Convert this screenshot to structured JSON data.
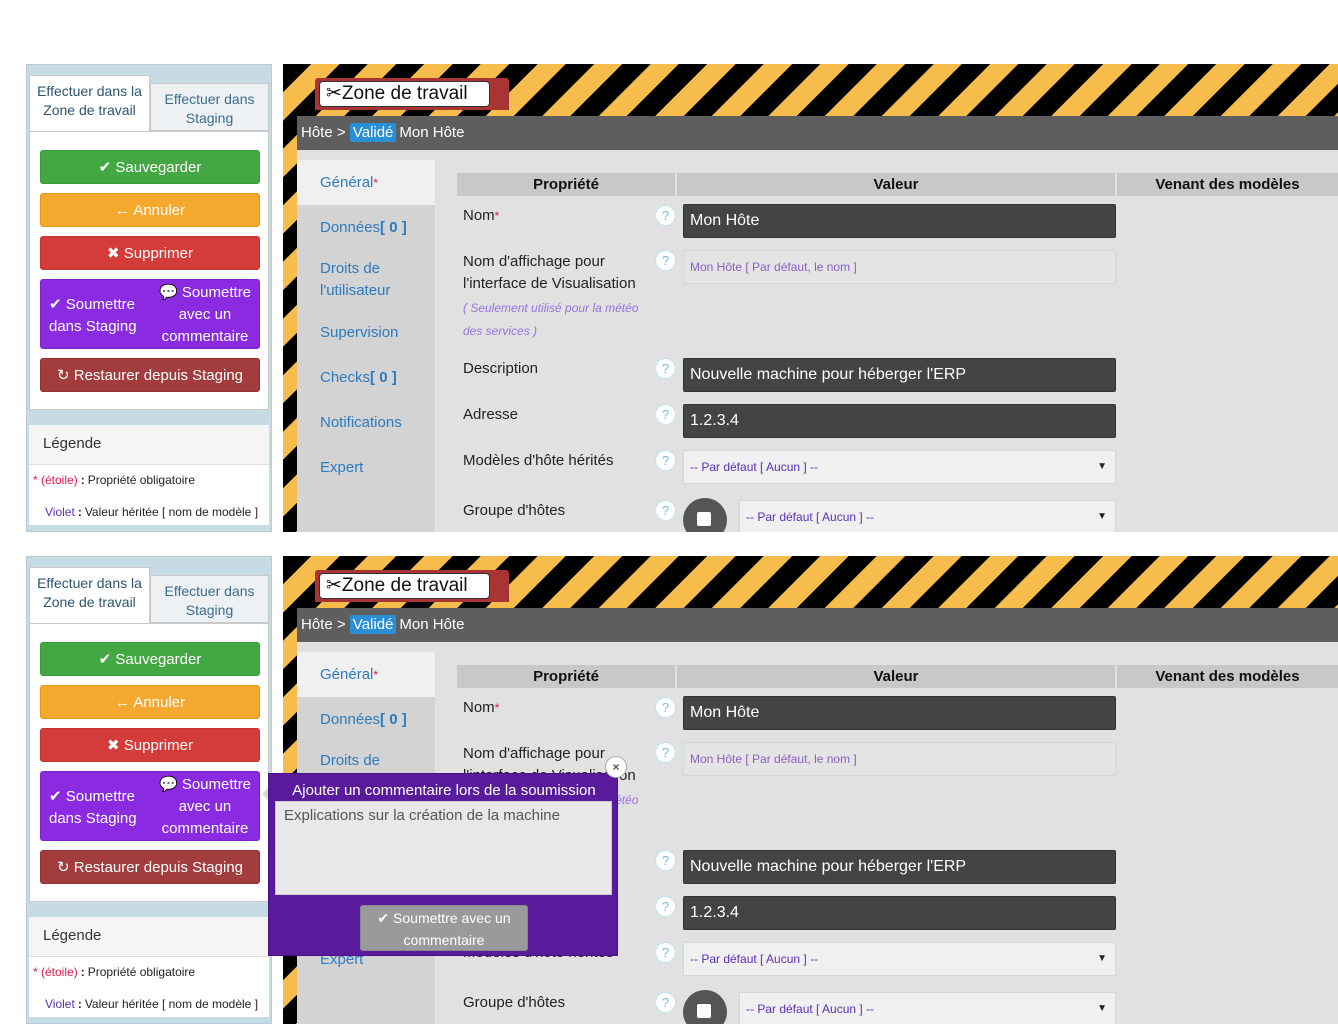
{
  "tabs": {
    "active": "Effectuer dans la Zone de travail",
    "inactive": "Effectuer dans Staging"
  },
  "buttons": {
    "save": "Sauvegarder",
    "cancel": "Annuler",
    "delete": "Supprimer",
    "submit_staging": "Soumettre dans Staging",
    "submit_comment": "Soumettre avec un commentaire",
    "restore": "Restaurer depuis Staging"
  },
  "legend": {
    "title": "Légende",
    "required_mark": "* (étoile)",
    "required_text": "Propriété obligatoire",
    "inherited_mark": "Violet",
    "inherited_text": "Valeur héritée [ nom de modèle ]",
    "separator": ":"
  },
  "zone_title": "Zone de travail",
  "breadcrumb": {
    "root": "Hôte >",
    "status": "Validé",
    "name": "Mon Hôte"
  },
  "nav": [
    {
      "label": "Général",
      "mark": "*"
    },
    {
      "label": "Données",
      "count": "[ 0 ]"
    },
    {
      "label": "Droits de l'utilisateur"
    },
    {
      "label": "Supervision"
    },
    {
      "label": "Checks",
      "count": "[ 0 ]"
    },
    {
      "label": "Notifications"
    },
    {
      "label": "Expert"
    }
  ],
  "table": {
    "col_property": "Propriété",
    "col_value": "Valeur",
    "col_models": "Venant des modèles"
  },
  "rows": {
    "name_label": "Nom",
    "name_mark": "*",
    "name_value": "Mon Hôte",
    "display_label": "Nom d'affichage pour l'interface de Visualisation",
    "display_note": "( Seulement utilisé pour la météo des services )",
    "display_value": "Mon Hôte [ Par défaut, le nom ]",
    "desc_label": "Description",
    "desc_value": "Nouvelle machine pour héberger l'ERP",
    "addr_label": "Adresse",
    "addr_value": "1.2.3.4",
    "templates_label": "Modèles d'hôte hérités",
    "templates_value": "-- Par défaut [ Aucun ] --",
    "group_label": "Groupe d'hôtes",
    "group_value": "-- Par défaut [ Aucun ] --"
  },
  "popover": {
    "title": "Ajouter un commentaire lors de la soumission",
    "text": "Explications sur la création de la machine",
    "button": "Soumettre avec un commentaire",
    "close": "×"
  },
  "icons": {
    "help": "?",
    "check": "✔",
    "back": "←",
    "cross": "✖",
    "check_circle": "✔",
    "comment": "💬",
    "restore": "↻",
    "tools": "✂",
    "arrow": "▼"
  }
}
